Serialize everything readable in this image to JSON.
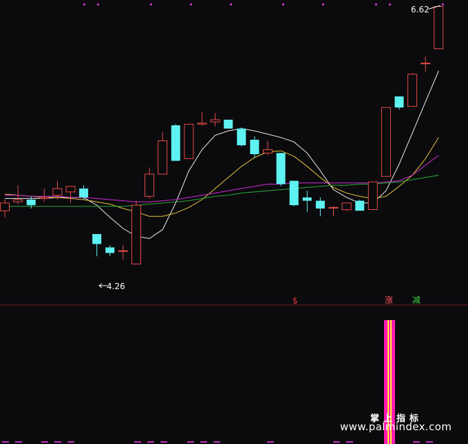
{
  "colors": {
    "background": "#0b0b0e",
    "up": "#e84b45",
    "down": "#5ef2f2",
    "ma5": "#f0f0f0",
    "ma10": "#e6c53a",
    "ma20": "#d22ad8",
    "ma60": "#2ea83a",
    "volume_bar_outer": "#ff1ab5",
    "volume_bar_inner": "#ffee33",
    "signal_s": "#e33b3b",
    "signal_zhang": "#ff5a5a",
    "signal_jian": "#3fd33f",
    "panel_divider": "#7a1a1a",
    "dot_markers": "#c231c2"
  },
  "annotations": {
    "high_label": "6.62",
    "low_label": "4.26"
  },
  "signals": {
    "s_label": "$",
    "zhang_label": "涨",
    "jian_label": "减"
  },
  "watermark": {
    "chinese": "掌上指标",
    "url": "www.palmindex.com"
  },
  "chart_data": {
    "type": "candlestick",
    "price_range": [
      3.95,
      6.66
    ],
    "candles": [
      {
        "open": 4.78,
        "high": 4.88,
        "low": 4.72,
        "close": 4.85
      },
      {
        "open": 4.86,
        "high": 5.01,
        "low": 4.84,
        "close": 4.88
      },
      {
        "open": 4.88,
        "high": 4.91,
        "low": 4.8,
        "close": 4.83
      },
      {
        "open": 4.89,
        "high": 4.98,
        "low": 4.86,
        "close": 4.9
      },
      {
        "open": 4.92,
        "high": 5.05,
        "low": 4.88,
        "close": 4.98
      },
      {
        "open": 4.95,
        "high": 5.0,
        "low": 4.85,
        "close": 5.0
      },
      {
        "open": 4.98,
        "high": 5.01,
        "low": 4.88,
        "close": 4.9
      },
      {
        "open": 4.57,
        "high": 4.57,
        "low": 4.37,
        "close": 4.48
      },
      {
        "open": 4.45,
        "high": 4.47,
        "low": 4.37,
        "close": 4.4
      },
      {
        "open": 4.42,
        "high": 4.47,
        "low": 4.34,
        "close": 4.42
      },
      {
        "open": 4.3,
        "high": 4.87,
        "low": 4.3,
        "close": 4.83
      },
      {
        "open": 4.91,
        "high": 5.17,
        "low": 4.89,
        "close": 5.11
      },
      {
        "open": 5.11,
        "high": 5.49,
        "low": 5.11,
        "close": 5.41
      },
      {
        "open": 5.55,
        "high": 5.56,
        "low": 5.23,
        "close": 5.23
      },
      {
        "open": 5.25,
        "high": 5.56,
        "low": 5.25,
        "close": 5.56
      },
      {
        "open": 5.56,
        "high": 5.67,
        "low": 5.55,
        "close": 5.57
      },
      {
        "open": 5.58,
        "high": 5.66,
        "low": 5.54,
        "close": 5.6
      },
      {
        "open": 5.6,
        "high": 5.6,
        "low": 5.52,
        "close": 5.52
      },
      {
        "open": 5.52,
        "high": 5.53,
        "low": 5.36,
        "close": 5.37
      },
      {
        "open": 5.42,
        "high": 5.45,
        "low": 5.26,
        "close": 5.29
      },
      {
        "open": 5.3,
        "high": 5.41,
        "low": 5.28,
        "close": 5.33
      },
      {
        "open": 5.3,
        "high": 5.3,
        "low": 5.0,
        "close": 5.02
      },
      {
        "open": 5.05,
        "high": 5.05,
        "low": 4.82,
        "close": 4.83
      },
      {
        "open": 4.9,
        "high": 4.96,
        "low": 4.77,
        "close": 4.87
      },
      {
        "open": 4.87,
        "high": 4.9,
        "low": 4.73,
        "close": 4.8
      },
      {
        "open": 4.81,
        "high": 4.82,
        "low": 4.73,
        "close": 4.81
      },
      {
        "open": 4.79,
        "high": 4.85,
        "low": 4.78,
        "close": 4.85
      },
      {
        "open": 4.87,
        "high": 4.88,
        "low": 4.78,
        "close": 4.78
      },
      {
        "open": 4.79,
        "high": 5.04,
        "low": 4.79,
        "close": 5.04
      },
      {
        "open": 5.09,
        "high": 5.71,
        "low": 5.09,
        "close": 5.71
      },
      {
        "open": 5.81,
        "high": 5.81,
        "low": 5.69,
        "close": 5.71
      },
      {
        "open": 5.72,
        "high": 6.02,
        "low": 5.72,
        "close": 6.01
      },
      {
        "open": 6.11,
        "high": 6.17,
        "low": 6.03,
        "close": 6.11
      },
      {
        "open": 6.24,
        "high": 6.62,
        "low": 6.24,
        "close": 6.62
      }
    ],
    "ma_lines": [
      {
        "color_key": "ma5",
        "values": [
          4.89,
          4.89,
          4.89,
          4.89,
          4.9,
          4.9,
          4.9,
          4.83,
          4.72,
          4.62,
          4.55,
          4.53,
          4.61,
          4.85,
          5.14,
          5.33,
          5.46,
          5.5,
          5.52,
          5.5,
          5.47,
          5.44,
          5.4,
          5.3,
          5.14,
          4.97,
          4.9,
          4.85,
          4.85,
          4.96,
          5.2,
          5.48,
          5.76,
          6.04
        ]
      },
      {
        "color_key": "ma10",
        "values": [
          4.93,
          4.92,
          4.91,
          4.9,
          4.9,
          4.89,
          4.88,
          4.86,
          4.84,
          4.8,
          4.77,
          4.73,
          4.73,
          4.76,
          4.81,
          4.88,
          4.98,
          5.08,
          5.18,
          5.26,
          5.31,
          5.32,
          5.27,
          5.18,
          5.08,
          4.99,
          4.94,
          4.91,
          4.89,
          4.91,
          5.0,
          5.1,
          5.25,
          5.44
        ]
      },
      {
        "color_key": "ma20",
        "values": [
          4.92,
          4.92,
          4.91,
          4.91,
          4.91,
          4.9,
          4.9,
          4.89,
          4.88,
          4.87,
          4.86,
          4.86,
          4.87,
          4.88,
          4.9,
          4.92,
          4.94,
          4.96,
          4.98,
          5.0,
          5.02,
          5.02,
          5.03,
          5.03,
          5.03,
          5.03,
          5.03,
          5.03,
          5.03,
          5.04,
          5.05,
          5.1,
          5.19,
          5.28
        ]
      },
      {
        "color_key": "ma60",
        "values": [
          4.82,
          4.82,
          4.82,
          4.82,
          4.82,
          4.82,
          4.82,
          4.82,
          4.82,
          4.82,
          4.83,
          4.84,
          4.85,
          4.86,
          4.87,
          4.89,
          4.91,
          4.92,
          4.94,
          4.95,
          4.96,
          4.97,
          4.98,
          4.99,
          5.0,
          5.01,
          5.01,
          5.02,
          5.02,
          5.03,
          5.04,
          5.06,
          5.08,
          5.1
        ]
      }
    ],
    "volume": {
      "bar_index": 29,
      "note": "single highlighted volume bar"
    }
  }
}
